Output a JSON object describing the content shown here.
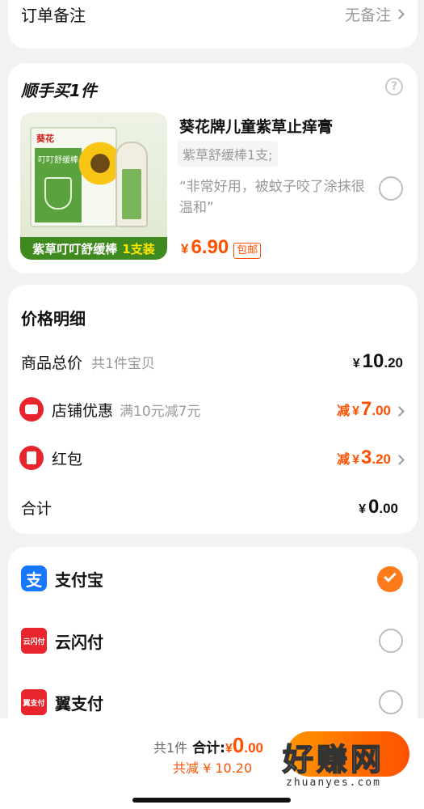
{
  "order_note": {
    "label": "订单备注",
    "value": "无备注"
  },
  "addon": {
    "title": "顺手买1件",
    "product": {
      "brand": "葵花",
      "box_text": "叮叮舒缓棒",
      "banner_left": "紫草叮叮舒缓棒",
      "banner_right": "1支装",
      "name": "葵花牌儿童紫草止痒膏",
      "spec": "紫草舒缓棒1支;",
      "review": "“非常好用，被蚊子咬了涂抹很温和”",
      "currency": "¥",
      "price": "6.90",
      "badge": "包邮"
    }
  },
  "price_detail": {
    "title": "价格明细",
    "rows": [
      {
        "label": "商品总价",
        "sub": "共1件宝贝",
        "prefix": "",
        "currency": "¥",
        "int": "10",
        "dec": ".20"
      },
      {
        "label": "店铺优惠",
        "sub": "满10元减7元",
        "prefix": "减",
        "currency": "¥",
        "int": "7",
        "dec": ".00"
      },
      {
        "label": "红包",
        "sub": "",
        "prefix": "减",
        "currency": "¥",
        "int": "3",
        "dec": ".20"
      },
      {
        "label": "合计",
        "sub": "",
        "prefix": "",
        "currency": "¥",
        "int": "0",
        "dec": ".00"
      }
    ]
  },
  "payment": {
    "methods": [
      {
        "label": "支付宝",
        "selected": true,
        "icon": "alipay-icon"
      },
      {
        "label": "云闪付",
        "selected": false,
        "icon": "unionpay-icon",
        "icon_text": "云闪付"
      },
      {
        "label": "翼支付",
        "selected": false,
        "icon": "bestpay-icon",
        "icon_text": "翼支付"
      }
    ]
  },
  "footer": {
    "count": "共1件",
    "total_label": "合计:",
    "total_currency": "¥",
    "total_int": "0",
    "total_dec": ".00",
    "saved": "共减 ¥ 10.20"
  },
  "watermark": {
    "main": "好赚网",
    "sub": "zhuanyes.com"
  },
  "colors": {
    "accent": "#ff5000",
    "alipay": "#1677ff",
    "red": "#e8242c",
    "orange": "#ff7a1a"
  }
}
